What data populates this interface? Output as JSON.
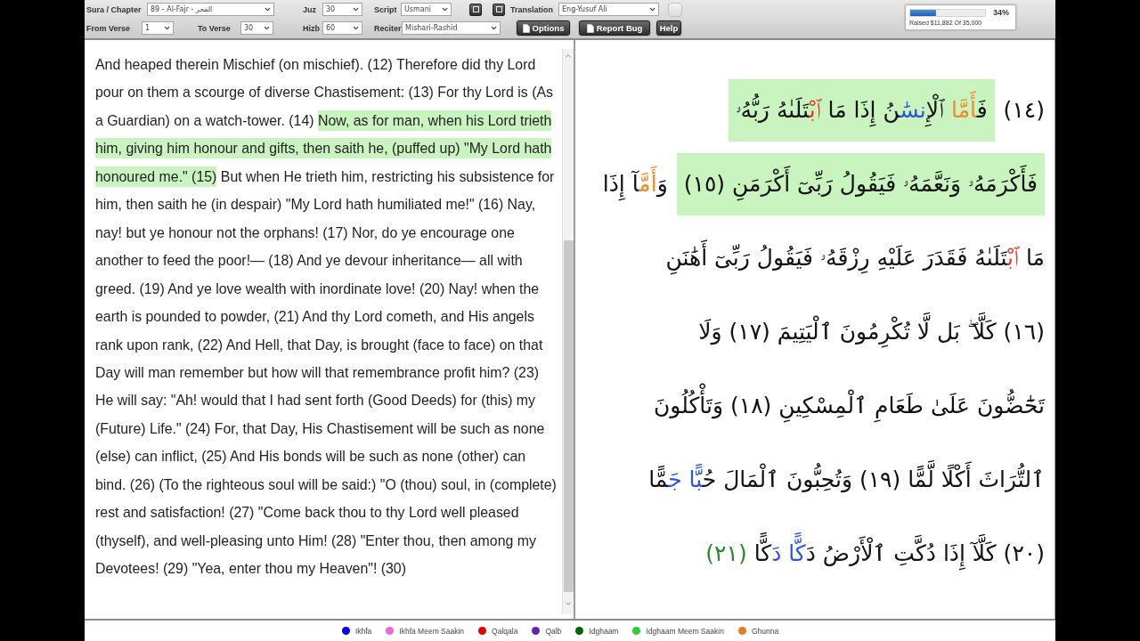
{
  "toolbar": {
    "sura_chapter": {
      "label": "Sura / Chapter",
      "value": "89 - Al-Fajr - الفجر"
    },
    "juz": {
      "label": "Juz",
      "value": "30"
    },
    "script": {
      "label": "Script",
      "value": "Usmani"
    },
    "icon_buttons": [
      {
        "kind": "square"
      },
      {
        "kind": "square"
      }
    ],
    "translation": {
      "label": "Translation",
      "value": "Eng-Yusuf Ali"
    },
    "extra_button": {
      "kind": "blank"
    },
    "from_verse": {
      "label": "From Verse",
      "value": "1"
    },
    "to_verse": {
      "label": "To Verse",
      "value": "30"
    },
    "hizb": {
      "label": "Hizb",
      "value": "60"
    },
    "reciter": {
      "label": "Reciter",
      "value": "Mishari-Rashid"
    },
    "options_button": {
      "kind": "document",
      "label": "Options"
    },
    "report_bug_button": {
      "kind": "document",
      "label": "Report Bug"
    },
    "help_button": {
      "kind": "text",
      "label": "Help"
    }
  },
  "donation": {
    "level": 0.34,
    "percent": "34%",
    "raised": "Raised $11,882 Of 35,000"
  },
  "translation": {
    "segments": [
      {
        "text": "And heaped therein Mischief (on mischief). (12) Therefore did thy Lord pour on them a scourge of diverse Chastisement: (13) For thy Lord is (As a Guardian) on a watch-tower. (14)",
        "selected": false
      },
      {
        "text": "Now, as for man, when his Lord trieth him, giving him honour and gifts, then saith he, (puffed up) \"My Lord hath honoured me.\" (15)",
        "selected": true
      },
      {
        "text": "But when He trieth him, restricting his subsistence for him, then saith he (in despair) \"My Lord hath humiliated me!\" (16) Nay, nay! but ye honour not the orphans! (17) Nor, do ye encourage one another to feed the poor!— (18) And ye devour inheritance— all with greed. (19) And ye love wealth with inordinate love! (20) Nay! when the earth is pounded to powder, (21) And thy Lord cometh, and His angels rank upon rank, (22) And Hell, that Day, is brought (face to face) on that Day will man remember but how will that remembrance profit him? (23) He will say: \"Ah! would that I had sent forth (Good Deeds) for (this) my (Future) Life.\" (24) For, that Day, His Chastisement will be such as none (else) can inflict, (25) And His bonds will be such as none (other) can bind. (26) (To the righteous soul will be said:) \"O (thou) soul, in (complete) rest and satisfaction! (27) \"Come back thou to thy Lord well pleased (thyself), and well-pleasing unto Him! (28) \"Enter thou, then among my Devotees! (29) \"Yea, enter thou my Heaven\"! (30)",
        "selected": false
      }
    ]
  },
  "quran": {
    "lines": [
      {
        "chunks": [
          {
            "selected": false,
            "segments": [
              {
                "text": "(١٤)"
              }
            ]
          },
          {
            "selected": true,
            "segments": [
              {
                "text": "فَ"
              },
              {
                "text": "أَمَّا",
                "color": "#f08a2a"
              },
              {
                "text": " ٱلْ"
              },
              {
                "text": "إِنسَٰ",
                "color": "#2f55d4"
              },
              {
                "text": "نُ إِذَا مَا "
              },
              {
                "text": "ٱبْ",
                "color": "#e23a2a"
              },
              {
                "text": "تَلَىٰهُ رَبُّهُۥ"
              }
            ]
          }
        ]
      },
      {
        "chunks": [
          {
            "selected": true,
            "segments": [
              {
                "text": "فَأَكْرَمَهُۥ وَنَعَّمَهُۥ فَيَقُولُ رَبِّىٓ أَكْرَمَنِ (١٥)"
              }
            ]
          },
          {
            "selected": false,
            "segments": [
              {
                "text": "وَ"
              },
              {
                "text": "أَمَّ",
                "color": "#f08a2a"
              },
              {
                "text": "آ إِذَا"
              }
            ]
          }
        ]
      },
      {
        "chunks": [
          {
            "selected": false,
            "segments": [
              {
                "text": "مَا "
              },
              {
                "text": "ٱبْ",
                "color": "#e23a2a"
              },
              {
                "text": "تَلَىٰهُ فَقَدَرَ عَلَيْهِ رِزْقَهُۥ فَيَقُولُ رَبِّىٓ أَهَٰنَنِ"
              }
            ]
          }
        ]
      },
      {
        "chunks": [
          {
            "selected": false,
            "segments": [
              {
                "text": "(١٦) كَلَّا ۖ بَل لَّا تُكْرِمُونَ ٱلْيَتِيمَ (١٧) وَلَا"
              }
            ]
          }
        ]
      },
      {
        "chunks": [
          {
            "selected": false,
            "segments": [
              {
                "text": "تَحَٰٓضُّونَ عَلَىٰ طَعَامِ ٱلْمِسْكِينِ (١٨) وَتَأْكُلُونَ"
              }
            ]
          }
        ]
      },
      {
        "chunks": [
          {
            "selected": false,
            "segments": [
              {
                "text": "ٱلتُّرَاثَ أَكْلًا لَّمًّا (١٩) وَتُحِبُّونَ ٱلْمَالَ حُ"
              },
              {
                "text": "بًّا جَ",
                "color": "#2f55d4"
              },
              {
                "text": "مًّا"
              }
            ]
          }
        ]
      },
      {
        "chunks": [
          {
            "selected": false,
            "segments": [
              {
                "text": "(٢٠) كَلَّآ إِذَا دُكَّتِ ٱلْأَرْضُ دَ"
              },
              {
                "text": "كًّا دَ",
                "color": "#2f55d4"
              },
              {
                "text": "كًّا "
              },
              {
                "text": "(٢١)",
                "color": "#2a8a2a"
              }
            ]
          }
        ]
      }
    ]
  },
  "legend": {
    "ikhfa": {
      "label": "Ikhfa",
      "color": "#0000dd"
    },
    "ikhfa_meem_saakin": {
      "label": "Ikhfa Meem Saakin",
      "color": "#ee66dd"
    },
    "qalqala": {
      "label": "Qalqala",
      "color": "#dd0000"
    },
    "qalb": {
      "label": "Qalb",
      "color": "#6622aa"
    },
    "idghaam": {
      "label": "Idghaam",
      "color": "#006600"
    },
    "idghaam_meem_saakin": {
      "label": "Idghaam Meem Saakin",
      "color": "#33cc33"
    },
    "ghunna": {
      "label": "Ghunna",
      "color": "#ee7722"
    }
  }
}
